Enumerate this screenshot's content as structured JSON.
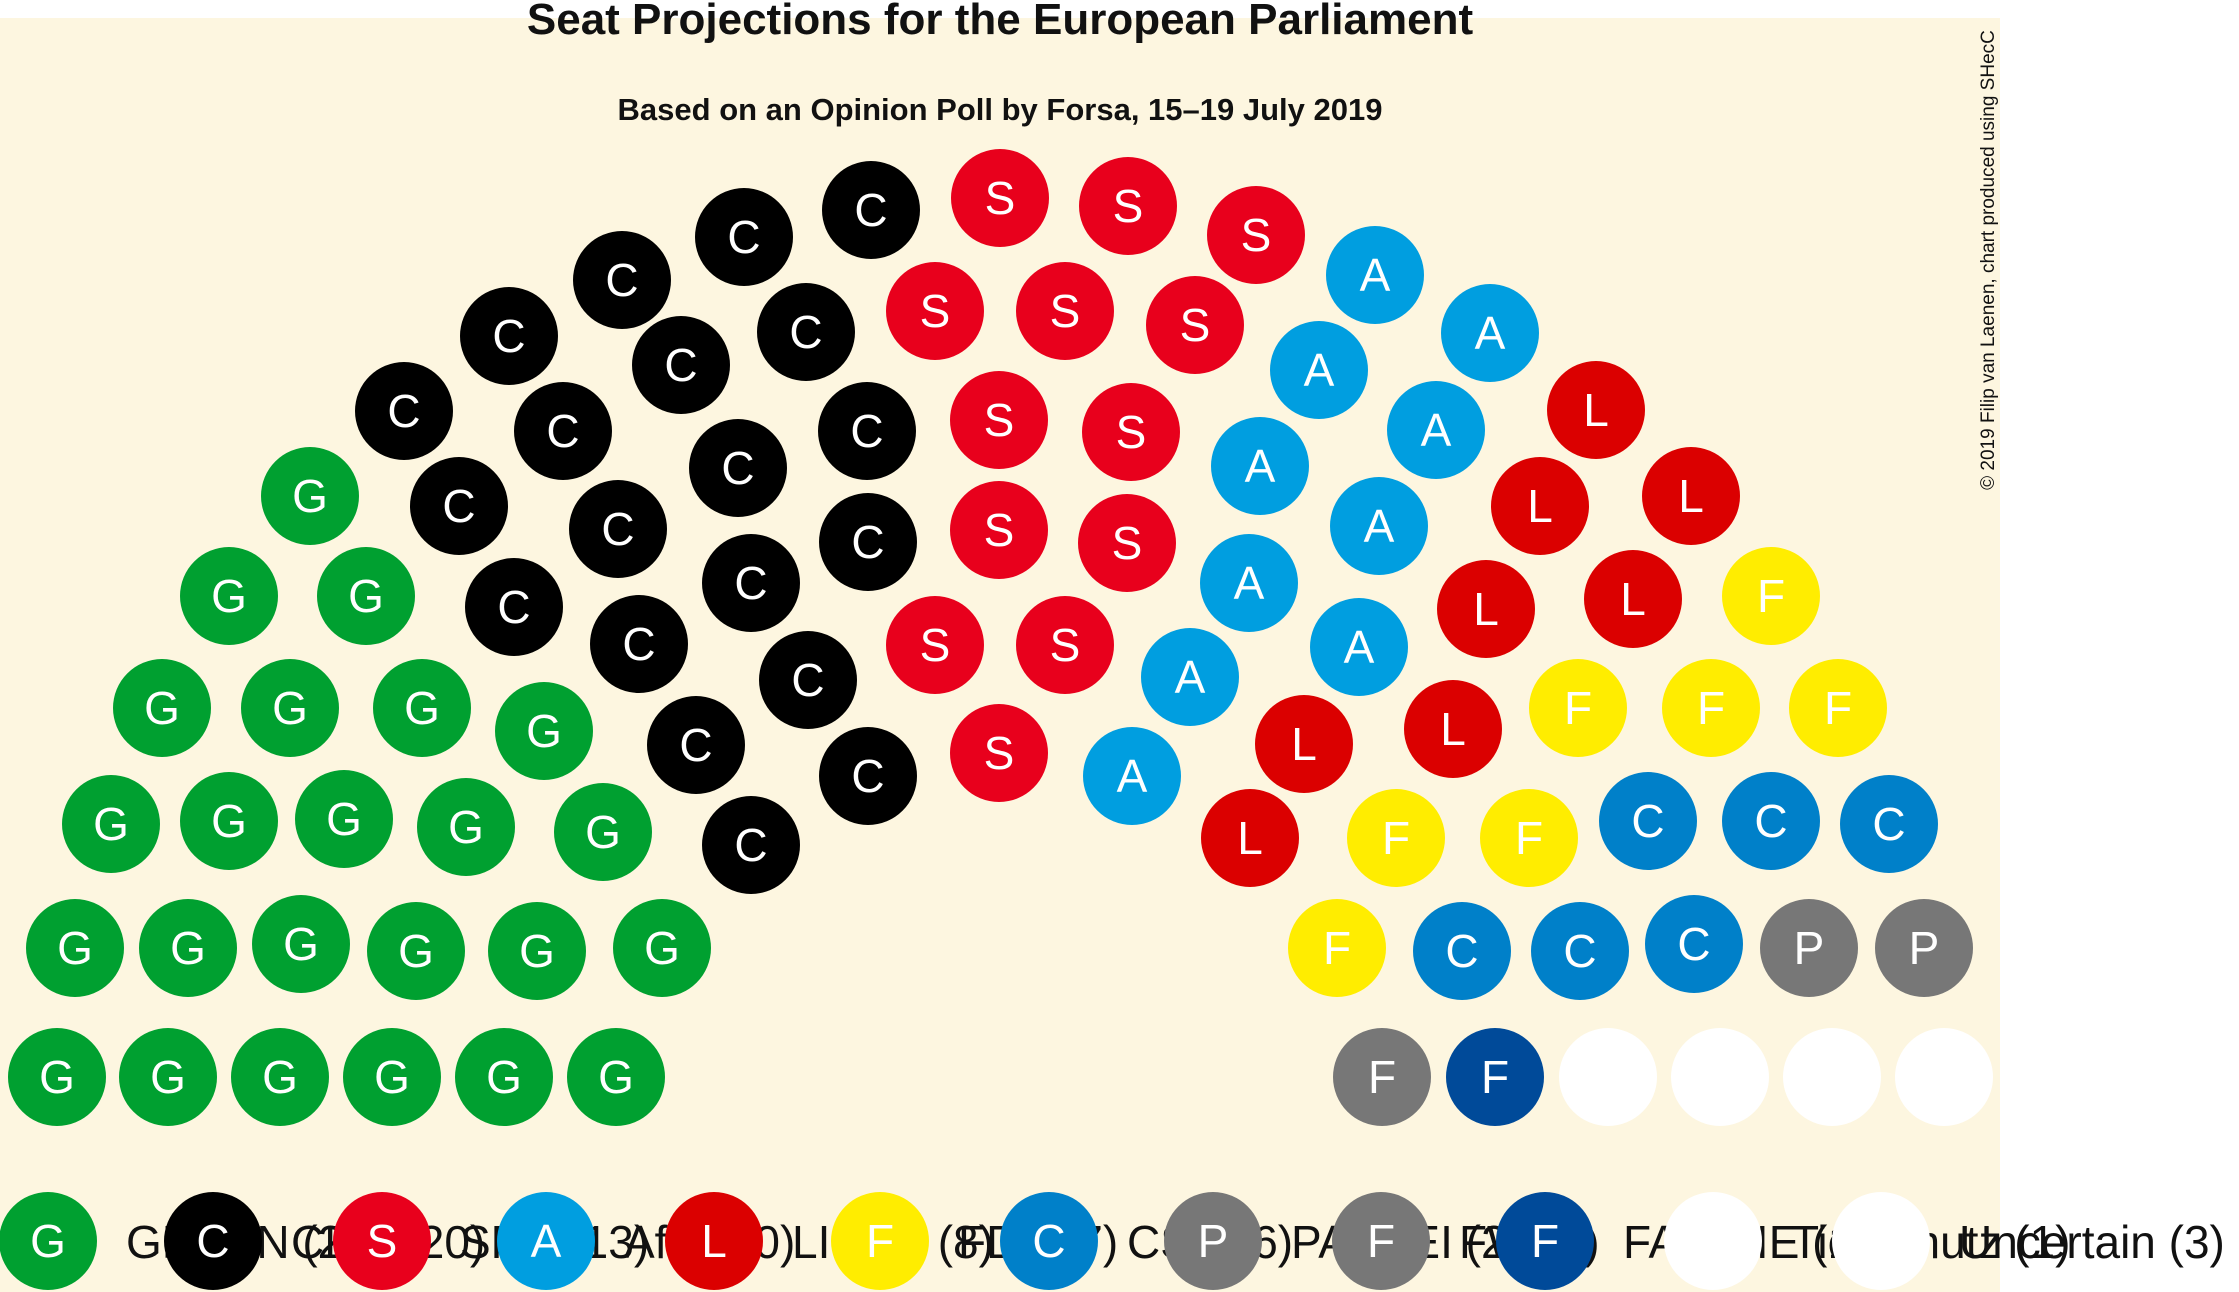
{
  "chart_data": {
    "type": "parliament",
    "title": "Seat Projections for the European Parliament",
    "subtitle": "Based on an Opinion Poll by Forsa, 15–19 July 2019",
    "credit": "© 2019 Filip van Laenen, chart produced using SHecC",
    "background": "#fdf6e0",
    "parties": [
      {
        "letter": "G",
        "color": "#00a030",
        "text_color": "#ffffff",
        "legend_label": "GREEN (29)",
        "seats": 29
      },
      {
        "letter": "C",
        "color": "#000000",
        "text_color": "#ffffff",
        "legend_label": "CDU (20)",
        "seats": 20
      },
      {
        "letter": "S",
        "color": "#e8001c",
        "text_color": "#ffffff",
        "legend_label": "SPD (13)",
        "seats": 13
      },
      {
        "letter": "A",
        "color": "#009ee0",
        "text_color": "#ffffff",
        "legend_label": "AfD (10)",
        "seats": 10
      },
      {
        "letter": "L",
        "color": "#db0000",
        "text_color": "#ffffff",
        "legend_label": "LINKE (8)",
        "seats": 8
      },
      {
        "letter": "F",
        "color": "#ffed00",
        "text_color": "#ffffff",
        "legend_label": "FDP (7)",
        "seats": 7
      },
      {
        "letter": "C",
        "color": "#0080c9",
        "text_color": "#ffffff",
        "legend_label": "CSU (6)",
        "seats": 6
      },
      {
        "letter": "P",
        "color": "#777777",
        "text_color": "#ffffff",
        "legend_label": "PARTEI (2)",
        "seats": 2
      },
      {
        "letter": "F",
        "color": "#777777",
        "text_color": "#ffffff",
        "legend_label": "FW (1)",
        "seats": 1
      },
      {
        "letter": "F",
        "color": "#004a99",
        "text_color": "#ffffff",
        "legend_label": "FAMILIE (1)",
        "seats": 1
      },
      {
        "letter": "",
        "color": "#ffffff",
        "text_color": "#ffffff",
        "legend_label": "Tierschutz (1)",
        "seats": 1
      },
      {
        "letter": "",
        "color": "#ffffff",
        "text_color": "#ffffff",
        "legend_label": "Uncertain (3)",
        "seats": 3
      }
    ],
    "seat_rows": [
      [
        "G",
        "G",
        "G",
        "G",
        "G",
        "G"
      ],
      [
        "G",
        "G",
        "G",
        "G",
        "G",
        "G"
      ],
      [
        "G",
        "G",
        "G",
        "G",
        "G"
      ],
      [
        "G",
        "G",
        "G",
        "G"
      ],
      [
        "G",
        "G"
      ],
      [
        "G"
      ],
      [
        "C",
        "C",
        "C",
        "C",
        "C",
        "C",
        "C",
        "C",
        "C",
        "C",
        "C",
        "C",
        "C",
        "C",
        "C",
        "C",
        "C",
        "C",
        "C",
        "C"
      ],
      [
        "S",
        "S",
        "S",
        "S",
        "S",
        "S",
        "S",
        "S",
        "S",
        "S",
        "S",
        "S",
        "S"
      ],
      [
        "A",
        "A",
        "A",
        "A",
        "A",
        "A",
        "A",
        "A",
        "A",
        "A"
      ],
      [
        "L",
        "L",
        "L",
        "L",
        "L",
        "L",
        "L",
        "L"
      ],
      [
        "F",
        "F",
        "F",
        "F",
        "F",
        "F",
        "F"
      ]
    ]
  }
}
